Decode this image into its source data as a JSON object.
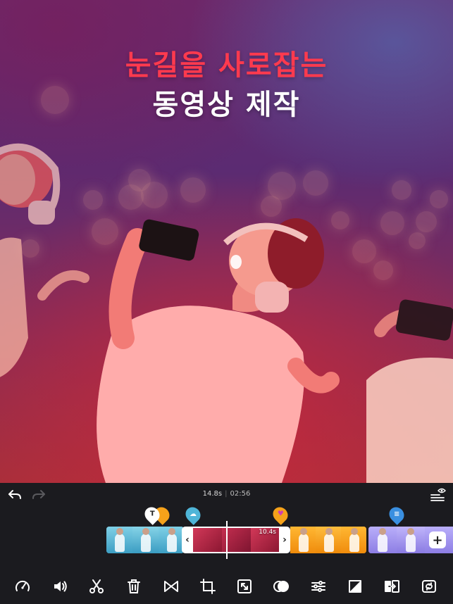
{
  "hero": {
    "headline_line1": "눈길을 사로잡는",
    "headline_line2": "동영상 제작"
  },
  "editor": {
    "current_time": "14.8s",
    "total_time": "02:56",
    "selected_clip_duration": "10.4s",
    "marker_text_label": "T",
    "add_clip_label": "+",
    "handle_left_label": "‹",
    "handle_right_label": "›"
  },
  "icons": {
    "undo": "undo-icon",
    "redo": "redo-icon",
    "layers": "layers-eye-icon",
    "tools": [
      "speed-icon",
      "volume-icon",
      "scissors-icon",
      "trash-icon",
      "transition-icon",
      "crop-icon",
      "resize-icon",
      "blend-icon",
      "adjust-icon",
      "background-icon",
      "replace-icon",
      "rotate-icon"
    ]
  },
  "colors": {
    "accent_red": "#ff3a4e",
    "clip_orange": "#f6a21a",
    "clip_purple": "#a79bf0",
    "clip_teal": "#4fb5d8"
  }
}
